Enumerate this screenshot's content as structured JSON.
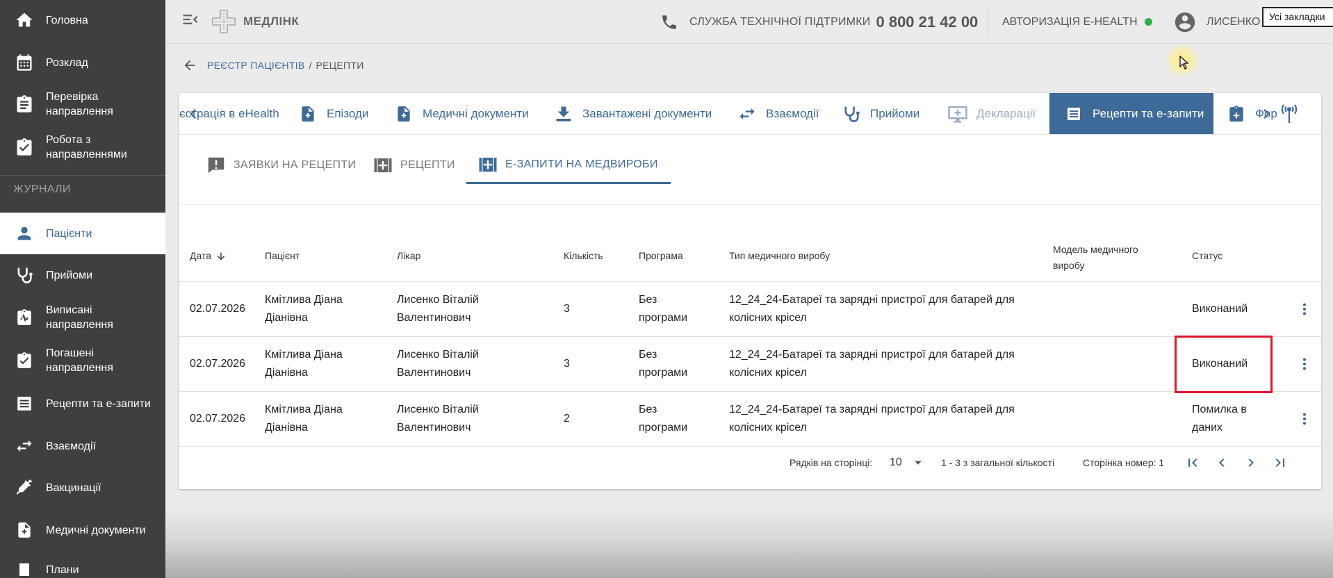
{
  "sidebar": {
    "items": [
      {
        "label": "Головна",
        "icon": "home-icon"
      },
      {
        "label": "Розклад",
        "icon": "calendar-icon"
      },
      {
        "label": "Перевірка направлення",
        "icon": "clipboard-check-icon"
      },
      {
        "label": "Робота з направленнями",
        "icon": "clipboard-list-icon"
      },
      {
        "label": "Пацієнти",
        "icon": "person-icon"
      },
      {
        "label": "Прийоми",
        "icon": "stethoscope-icon"
      },
      {
        "label": "Виписані направлення",
        "icon": "clipboard-pulse-icon"
      },
      {
        "label": "Погашені направлення",
        "icon": "clipboard-done-icon"
      },
      {
        "label": "Рецепти та е-запити",
        "icon": "receipt-icon"
      },
      {
        "label": "Взаємодії",
        "icon": "swap-icon"
      },
      {
        "label": "Вакцинації",
        "icon": "syringe-icon"
      },
      {
        "label": "Медичні документи",
        "icon": "medical-document-icon"
      },
      {
        "label": "Плани",
        "icon": "plan-icon"
      }
    ],
    "section_label": "ЖУРНАЛИ"
  },
  "header": {
    "logo_text": "МЕДЛІНК",
    "support_label": "СЛУЖБА ТЕХНІЧНОЇ ПІДТРИМКИ",
    "support_phone": "0 800 21 42 00",
    "auth_label": "АВТОРИЗАЦІЯ E-HEALTH",
    "user_name": "ЛИСЕНКО",
    "bookmarks_label": "Усі закладки"
  },
  "breadcrumb": {
    "parent": "РЕЄСТР ПАЦІЄНТІВ",
    "separator": "/",
    "current": "РЕЦЕПТИ"
  },
  "tabs": [
    {
      "label": "єстрація в eHealth",
      "icon": "none"
    },
    {
      "label": "Епізоди",
      "icon": "document-plus-icon"
    },
    {
      "label": "Медичні документи",
      "icon": "document-plus-icon"
    },
    {
      "label": "Завантажені документи",
      "icon": "download-icon"
    },
    {
      "label": "Взаємодії",
      "icon": "swap-icon"
    },
    {
      "label": "Прийоми",
      "icon": "stethoscope-icon"
    },
    {
      "label": "Декларації",
      "icon": "monitor-plus-icon"
    },
    {
      "label": "Рецепти та е-запити",
      "icon": "receipt-icon"
    },
    {
      "label": "Фор",
      "icon": "clipboard-plus-icon"
    }
  ],
  "subtabs": [
    {
      "label": "ЗАЯВКИ НА РЕЦЕПТИ",
      "icon": "alert-box-icon"
    },
    {
      "label": "РЕЦЕПТИ",
      "icon": "medical-box-icon"
    },
    {
      "label": "Е-ЗАПИТИ НА МЕДВИРОБИ",
      "icon": "medical-box-icon"
    }
  ],
  "table": {
    "columns": [
      "Дата",
      "Пацієнт",
      "Лікар",
      "Кількість",
      "Програма",
      "Тип медичного виробу",
      "Модель медичного виробу",
      "Статус"
    ],
    "rows": [
      {
        "date": "02.07.2026",
        "patient": "Кмітлива Діана Діанівна",
        "doctor": "Лисенко Віталій Валентинович",
        "qty": "3",
        "program": "Без програми",
        "type": "12_24_24-Батареї та зарядні пристрої для батарей для колісних крісел",
        "model": "",
        "status": "Виконаний"
      },
      {
        "date": "02.07.2026",
        "patient": "Кмітлива Діана Діанівна",
        "doctor": "Лисенко Віталій Валентинович",
        "qty": "3",
        "program": "Без програми",
        "type": "12_24_24-Батареї та зарядні пристрої для батарей для колісних крісел",
        "model": "",
        "status": "Виконаний"
      },
      {
        "date": "02.07.2026",
        "patient": "Кмітлива Діана Діанівна",
        "doctor": "Лисенко Віталій Валентинович",
        "qty": "2",
        "program": "Без програми",
        "type": "12_24_24-Батареї та зарядні пристрої для батарей для колісних крісел",
        "model": "",
        "status": "Помилка в даних"
      }
    ]
  },
  "pagination": {
    "rows_label": "Рядків на сторінці:",
    "rows_value": "10",
    "range": "1 - 3 з загальної кількості",
    "page_label": "Сторінка номер: 1"
  },
  "colors": {
    "accent": "#3d6a98",
    "sidebar": "#3f3f3f",
    "online": "#2eb34a",
    "highlight": "#e0162b"
  }
}
